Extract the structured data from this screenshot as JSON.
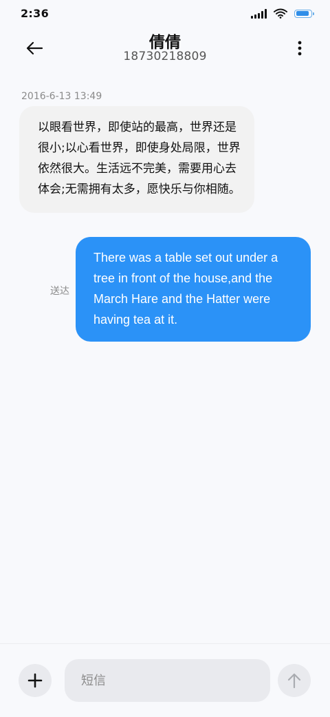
{
  "status_bar": {
    "time": "2:36",
    "battery_level": 0.92,
    "icons": [
      "signal-icon",
      "wifi-icon",
      "battery-icon"
    ]
  },
  "header": {
    "back_icon": "arrow-left-icon",
    "contact_name": "倩倩",
    "contact_number": "18730218809",
    "more_icon": "more-vertical-icon"
  },
  "conversation": {
    "timestamp": "2016-6-13 13:49",
    "messages": [
      {
        "direction": "incoming",
        "text": "以眼看世界，即使站的最高，世界还是很小;以心看世界，即使身处局限，世界依然很大。生活远不完美，需要用心去体会;无需拥有太多，愿快乐与你相随。"
      },
      {
        "direction": "outgoing",
        "text": "There was a table set out under a tree in front of the house,and the March Hare and the Hatter were having tea at it.",
        "status": "送达"
      }
    ]
  },
  "input_bar": {
    "add_icon": "plus-icon",
    "placeholder": "短信",
    "value": "",
    "send_icon": "arrow-up-icon"
  },
  "colors": {
    "outgoing_bubble": "#2b92f7",
    "incoming_bubble": "#f2f2f2",
    "background": "#f8f9fc",
    "battery": "#2f8ee8"
  }
}
